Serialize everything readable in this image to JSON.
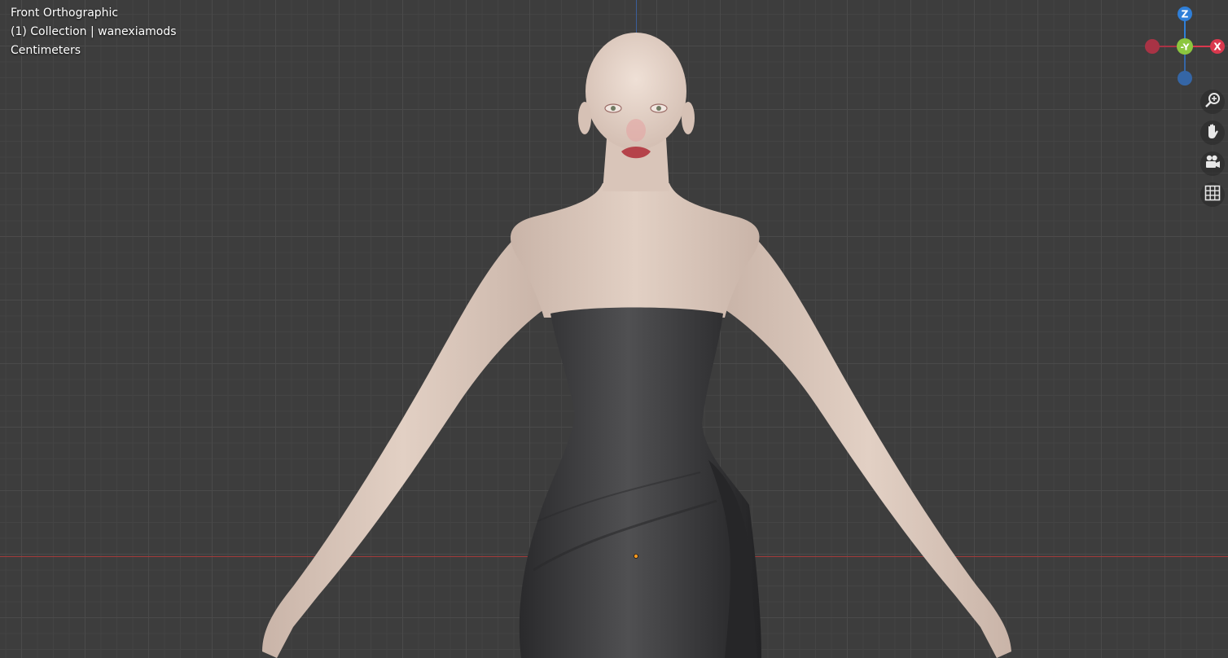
{
  "viewport": {
    "view_name": "Front Orthographic",
    "collection_info": "(1) Collection | wanexiamods",
    "units": "Centimeters"
  },
  "gizmo": {
    "z_label": "Z",
    "y_label": "-Y",
    "x_label": "X",
    "colors": {
      "x": "#d9384d",
      "y": "#8cc63f",
      "z": "#2f7fd8",
      "x_neg": "#a83345",
      "z_neg": "#3566a6"
    }
  },
  "nav_buttons": [
    {
      "icon": "zoom-icon"
    },
    {
      "icon": "pan-hand-icon"
    },
    {
      "icon": "camera-icon"
    },
    {
      "icon": "grid-icon"
    }
  ],
  "colors": {
    "background": "#3d3d3d",
    "skin": "#dcc9bd",
    "dress": "#3a3a3c"
  }
}
